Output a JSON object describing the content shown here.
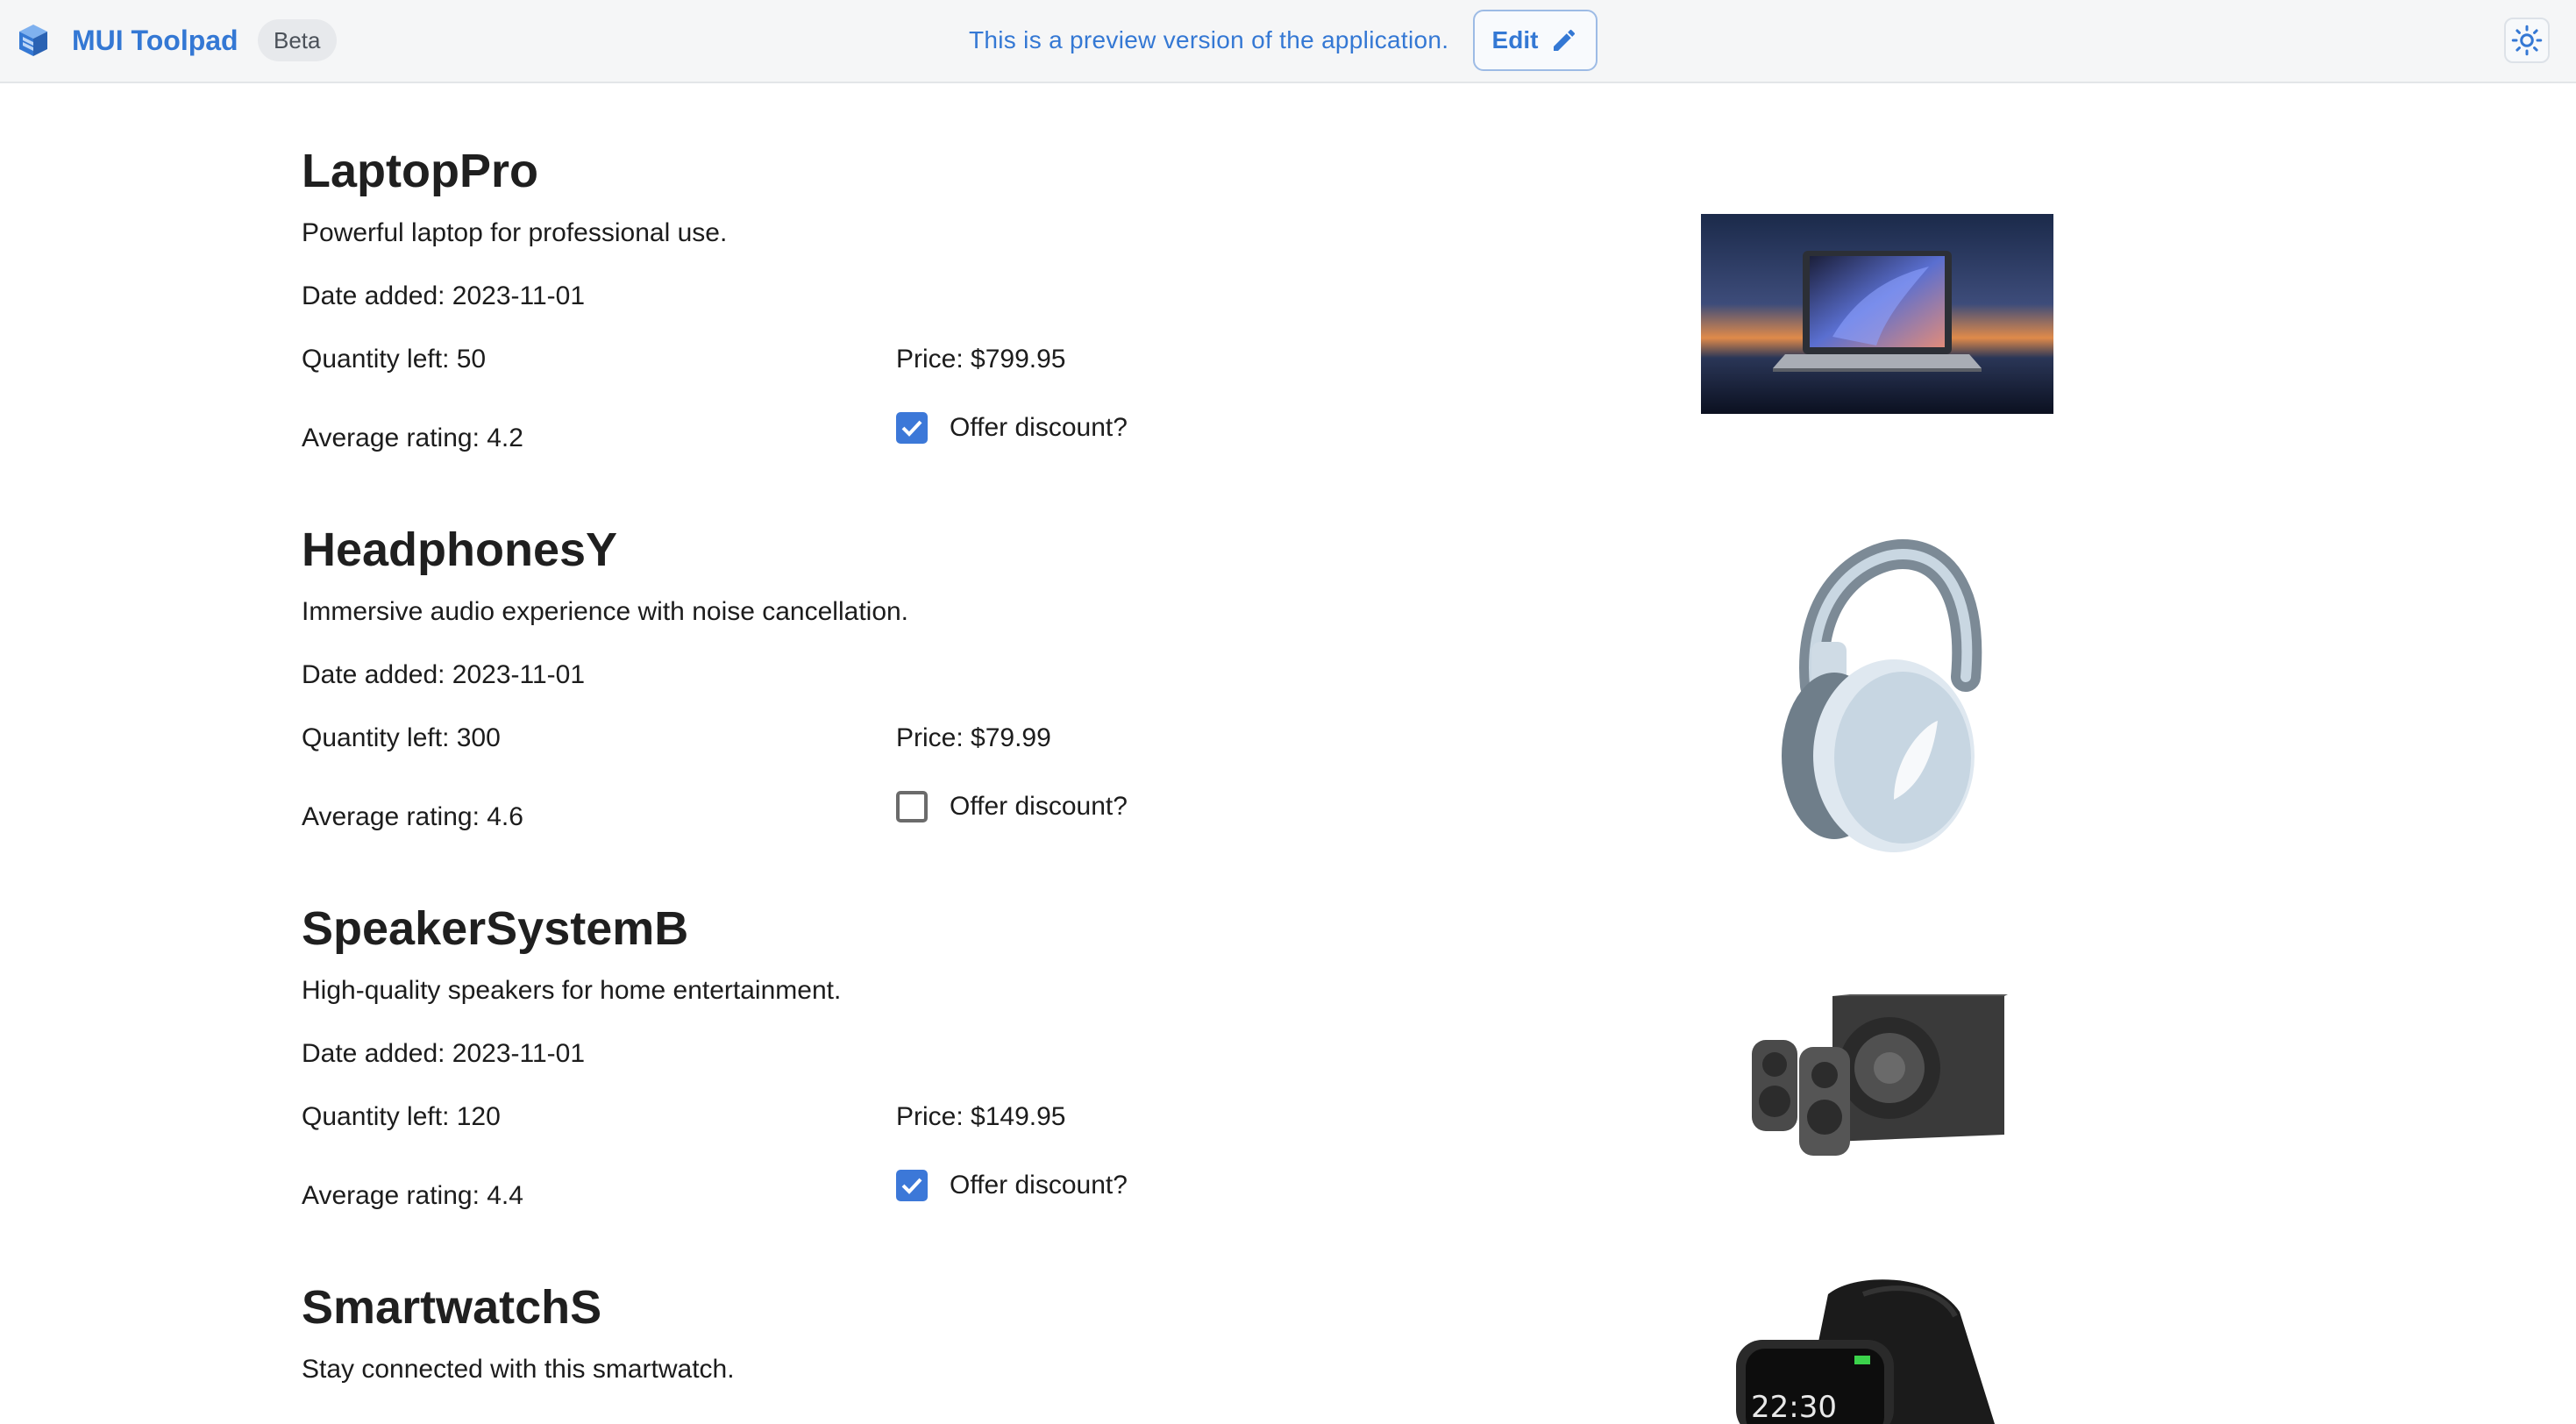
{
  "header": {
    "app_title": "MUI Toolpad",
    "beta_label": "Beta",
    "preview_notice": "This is a preview version of the application.",
    "edit_label": "Edit",
    "logo_icon": "toolpad-logo-icon",
    "edit_icon": "pencil-icon",
    "theme_icon": "sun-icon",
    "accent_color": "#3478d4"
  },
  "labels": {
    "date_added": "Date added: ",
    "quantity_left": "Quantity left: ",
    "price": "Price: ",
    "average_rating": "Average rating: ",
    "offer_discount": "Offer discount?"
  },
  "products": [
    {
      "name": "LaptopPro",
      "description": "Powerful laptop for professional use.",
      "date_added": "2023-11-01",
      "quantity_left": "50",
      "price": "$799.95",
      "average_rating": "4.2",
      "offer_discount": true,
      "image": "laptop-image"
    },
    {
      "name": "HeadphonesY",
      "description": "Immersive audio experience with noise cancellation.",
      "date_added": "2023-11-01",
      "quantity_left": "300",
      "price": "$79.99",
      "average_rating": "4.6",
      "offer_discount": false,
      "image": "headphones-image"
    },
    {
      "name": "SpeakerSystemB",
      "description": "High-quality speakers for home entertainment.",
      "date_added": "2023-11-01",
      "quantity_left": "120",
      "price": "$149.95",
      "average_rating": "4.4",
      "offer_discount": true,
      "image": "speaker-system-image"
    },
    {
      "name": "SmartwatchS",
      "description": "Stay connected with this smartwatch.",
      "image": "smartwatch-image",
      "image_text": "22:30"
    }
  ]
}
